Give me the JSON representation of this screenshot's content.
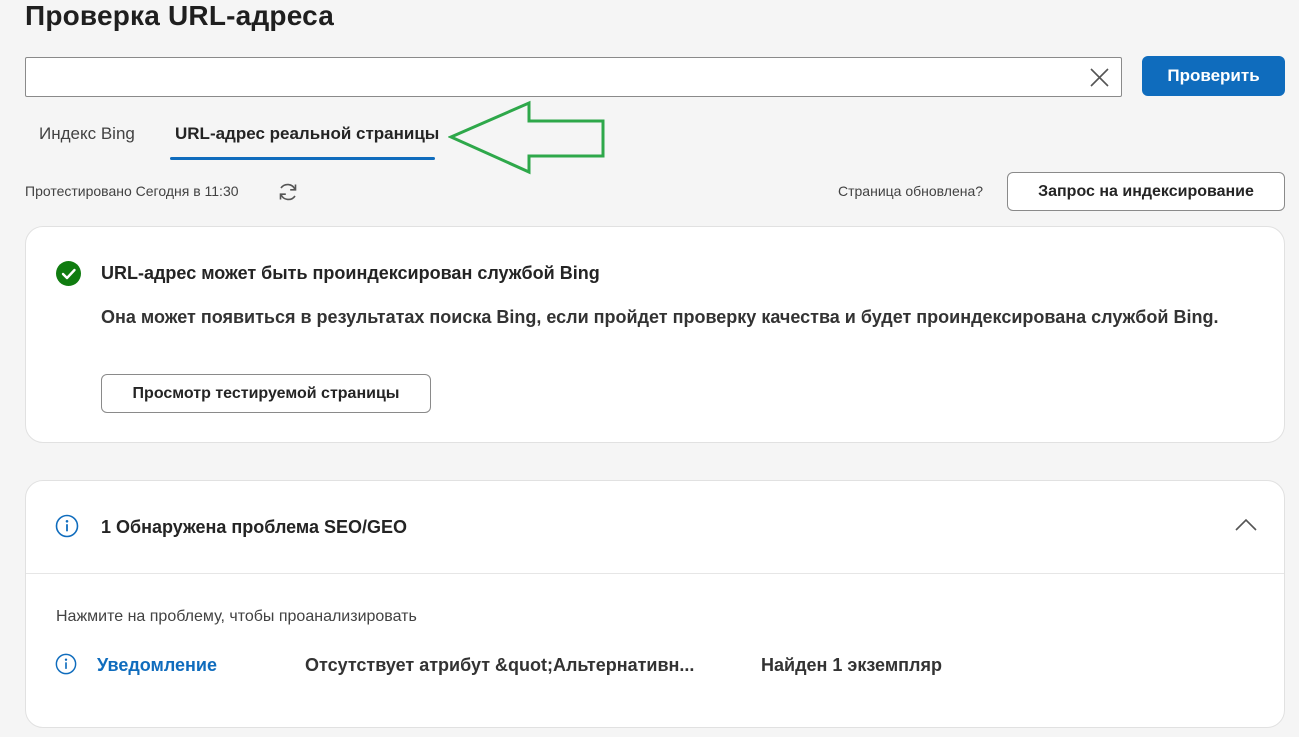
{
  "page": {
    "title": "Проверка URL-адреса"
  },
  "search": {
    "value": "",
    "placeholder": "",
    "check_label": "Проверить",
    "clear_icon": "close-icon"
  },
  "tabs": [
    {
      "label": "Индекс Bing",
      "active": false
    },
    {
      "label": "URL-адрес реальной страницы",
      "active": true
    }
  ],
  "annotation": {
    "icon": "arrow-left-icon",
    "color": "#2ea84a"
  },
  "status_bar": {
    "tested_text": "Протестировано Сегодня в 11:30",
    "refresh_icon": "refresh-icon",
    "updated_text": "Страница обновлена?",
    "request_index_label": "Запрос на индексирование"
  },
  "result": {
    "icon": "check-circle-icon",
    "title": "URL-адрес может быть проиндексирован службой Bing",
    "description": "Она может появиться в результатах поиска Bing, если пройдет проверку качества и будет проиндексирована службой Bing.",
    "view_button_label": "Просмотр тестируемой страницы"
  },
  "issues": {
    "icon": "info-icon",
    "title": "1 Обнаружена проблема SEO/GEO",
    "expanded": true,
    "hint": "Нажмите на проблему, чтобы проанализировать",
    "items": [
      {
        "level": "Уведомление",
        "description": "Отсутствует атрибут &quot;Альтернативн...",
        "count": "Найден 1 экземпляр"
      }
    ]
  },
  "colors": {
    "accent": "#0f6cbd",
    "success": "#107c10",
    "background": "#f5f5f5"
  }
}
